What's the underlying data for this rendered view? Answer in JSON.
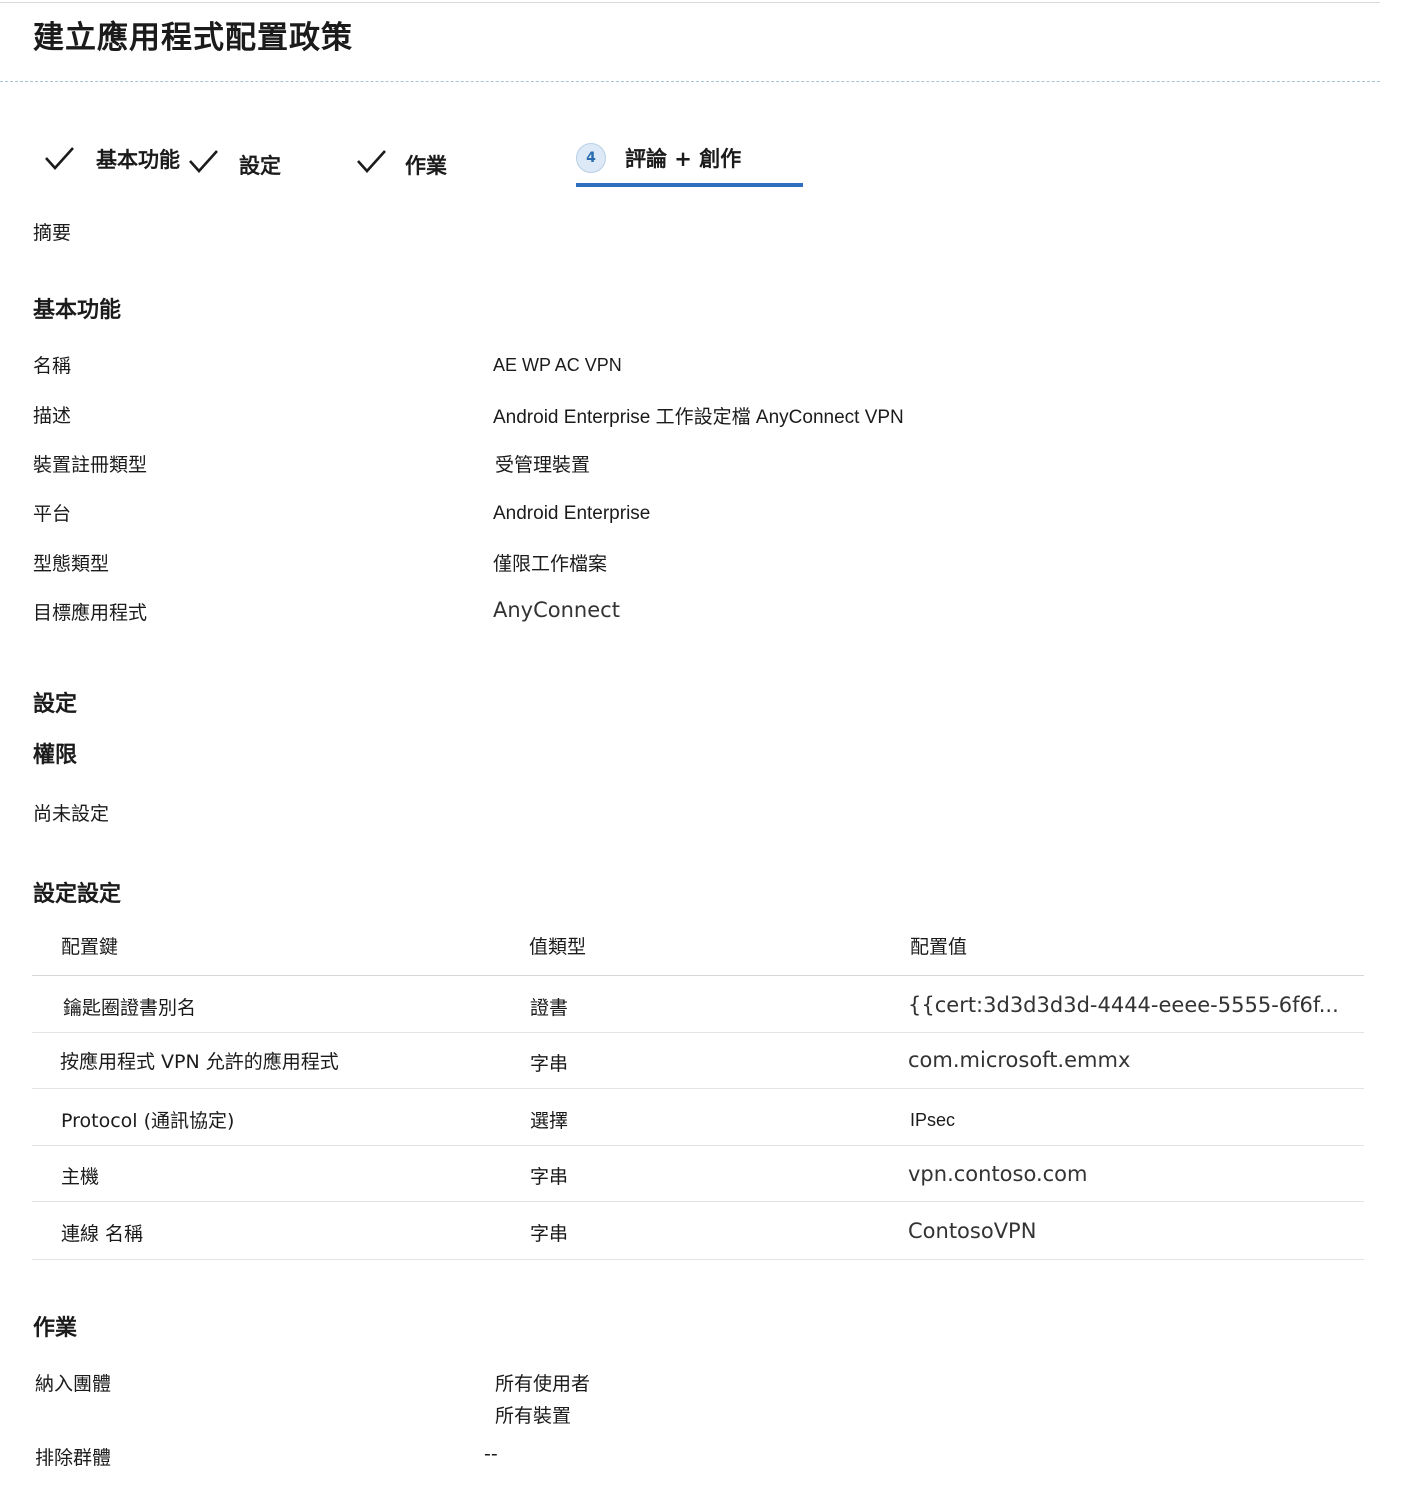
{
  "page": {
    "title": "建立應用程式配置政策"
  },
  "wizard": {
    "steps": [
      {
        "label": "基本功能",
        "state": "done"
      },
      {
        "label": "設定",
        "state": "done"
      },
      {
        "label": "作業",
        "state": "done"
      },
      {
        "number": "4",
        "label": "評論 + 創作",
        "state": "active"
      }
    ]
  },
  "summary": {
    "label": "摘要"
  },
  "basics": {
    "heading": "基本功能",
    "rows": [
      {
        "label": "名稱",
        "value": "AE WP AC VPN"
      },
      {
        "label": "描述",
        "value": "Android Enterprise 工作設定檔 AnyConnect VPN"
      },
      {
        "label": "裝置註冊類型",
        "value": "受管理裝置"
      },
      {
        "label": "平台",
        "value": "Android Enterprise"
      },
      {
        "label": "型態類型",
        "value": "僅限工作檔案"
      },
      {
        "label": "目標應用程式",
        "value": "AnyConnect"
      }
    ]
  },
  "settings": {
    "heading": "設定",
    "permissions_heading": "權限",
    "permissions_value": "尚未設定",
    "config_heading": "設定設定",
    "table": {
      "columns": [
        "配置鍵",
        "值類型",
        "配置值"
      ],
      "rows": [
        {
          "key": "鑰匙圈證書別名",
          "type": "證書",
          "value": "{{cert:3d3d3d3d-4444-eeee-5555-6f6f..."
        },
        {
          "key": "按應用程式 VPN 允許的應用程式",
          "type": "字串",
          "value": "com.microsoft.emmx"
        },
        {
          "key": "Protocol (通訊協定)",
          "type": "選擇",
          "value": "IPsec"
        },
        {
          "key": "主機",
          "type": "字串",
          "value": "vpn.contoso.com"
        },
        {
          "key": "連線 名稱",
          "type": "字串",
          "value": "ContosoVPN"
        }
      ]
    }
  },
  "assignments": {
    "heading": "作業",
    "included_label": "納入團體",
    "included_values": [
      "所有使用者",
      "所有裝置"
    ],
    "excluded_label": "排除群體",
    "excluded_value": "--"
  },
  "colors": {
    "accent": "#2f6fc0",
    "step_badge_bg": "#dde9f6",
    "divider": "#e3e3e3",
    "text": "#1b1b1b"
  },
  "icons": {
    "completed_step": "checkmark-icon"
  }
}
